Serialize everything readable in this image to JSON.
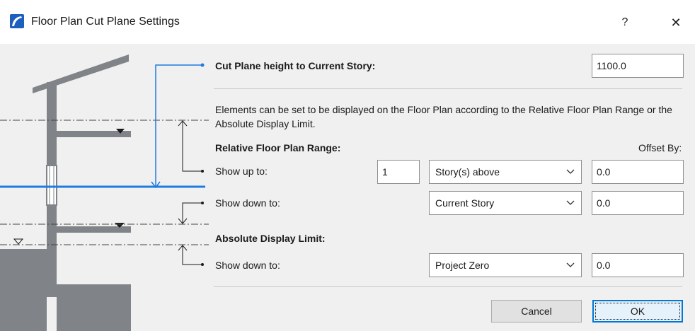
{
  "window": {
    "title": "Floor Plan Cut Plane Settings",
    "help_label": "?",
    "close_label": "✕",
    "icon": "archicad-app-icon"
  },
  "cut_plane": {
    "label": "Cut Plane height to Current Story:",
    "value": "1100.0"
  },
  "description": "Elements can be set to be displayed on the Floor Plan according to the Relative Floor Plan Range or the Absolute Display Limit.",
  "relative_range": {
    "heading": "Relative Floor Plan Range:",
    "offset_header": "Offset By:",
    "show_up": {
      "label": "Show up to:",
      "count": "1",
      "story": "Story(s) above",
      "offset": "0.0"
    },
    "show_down": {
      "label": "Show down to:",
      "story": "Current Story",
      "offset": "0.0"
    }
  },
  "absolute_limit": {
    "heading": "Absolute Display Limit:",
    "show_down": {
      "label": "Show down to:",
      "value": "Project Zero",
      "offset": "0.0"
    }
  },
  "buttons": {
    "cancel": "Cancel",
    "ok": "OK"
  },
  "colors": {
    "accent": "#1e7be0",
    "structure": "#808488"
  }
}
